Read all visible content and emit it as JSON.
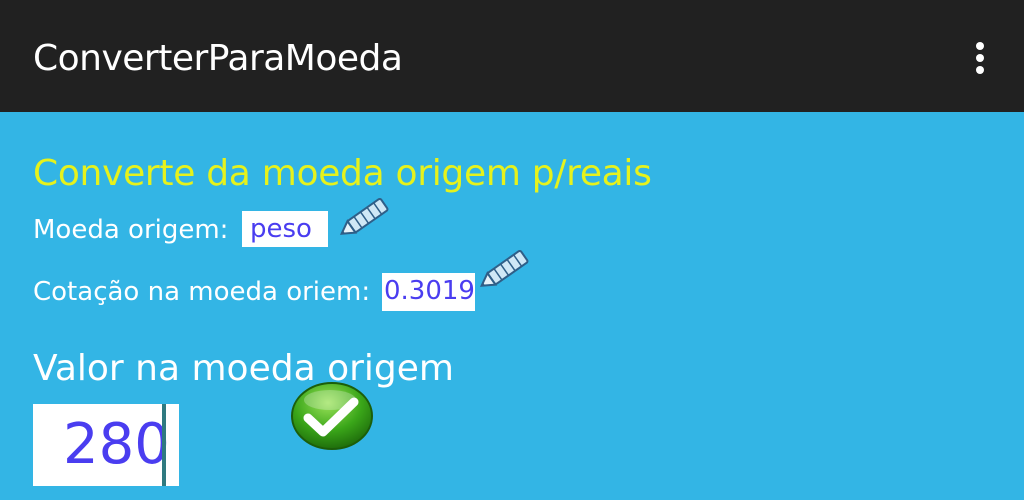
{
  "app": {
    "title": "ConverterParaMoeda"
  },
  "main": {
    "heading": "Converte da moeda origem p/reais",
    "origin_currency": {
      "label": "Moeda origem:",
      "value": "peso"
    },
    "rate": {
      "label": "Cotação na moeda oriem:",
      "value": "0.3019"
    },
    "amount": {
      "label": "Valor na moeda origem",
      "value": "280"
    }
  },
  "icons": {
    "overflow": "more-vert-icon",
    "edit": "pencil-icon",
    "confirm": "checkmark-icon"
  },
  "colors": {
    "background": "#33b5e5",
    "appbar": "#212121",
    "heading": "#e6f21c",
    "field_text": "#4a3df0",
    "confirm_green": "#3aa619"
  }
}
